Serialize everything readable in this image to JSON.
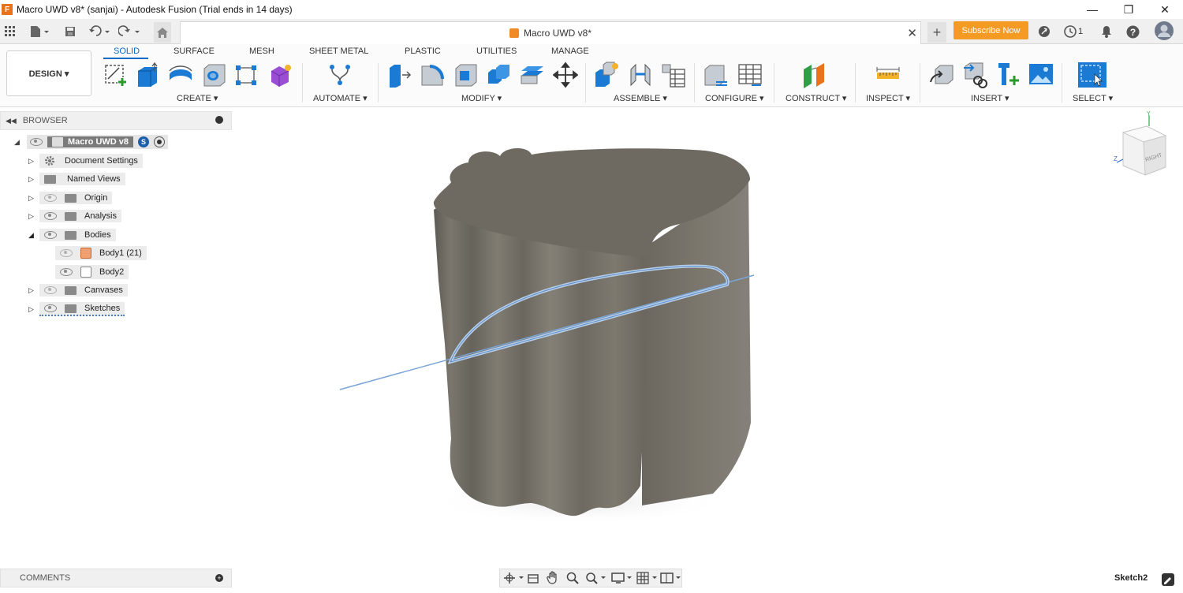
{
  "window": {
    "title": "Macro UWD v8* (sanjai) - Autodesk Fusion (Trial ends in 14 days)",
    "app_icon_letter": "F"
  },
  "doc_tab": {
    "title": "Macro UWD v8*"
  },
  "header": {
    "subscribe_label": "Subscribe Now",
    "jobs_count": "1"
  },
  "workspace": {
    "label": "DESIGN ▾"
  },
  "tabs": [
    "SOLID",
    "SURFACE",
    "MESH",
    "SHEET METAL",
    "PLASTIC",
    "UTILITIES",
    "MANAGE"
  ],
  "groups": [
    "CREATE ▾",
    "AUTOMATE ▾",
    "MODIFY ▾",
    "ASSEMBLE ▾",
    "CONFIGURE ▾",
    "CONSTRUCT ▾",
    "INSPECT ▾",
    "INSERT ▾",
    "SELECT ▾"
  ],
  "browser": {
    "title": "BROWSER",
    "root": "Macro UWD v8",
    "items": [
      {
        "label": "Document Settings"
      },
      {
        "label": "Named Views"
      },
      {
        "label": "Origin"
      },
      {
        "label": "Analysis"
      },
      {
        "label": "Bodies"
      },
      {
        "label": "Body1 (21)"
      },
      {
        "label": "Body2"
      },
      {
        "label": "Canvases"
      },
      {
        "label": "Sketches"
      }
    ]
  },
  "viewcube": {
    "face": "RIGHT",
    "axis_z": "Z",
    "axis_y": "Y"
  },
  "comments": {
    "label": "COMMENTS"
  },
  "status": {
    "active_sketch": "Sketch2"
  },
  "colors": {
    "accent": "#0a6ac4",
    "subscribe": "#f59a23",
    "body": "#77736a",
    "body_top": "#6e6a61"
  }
}
